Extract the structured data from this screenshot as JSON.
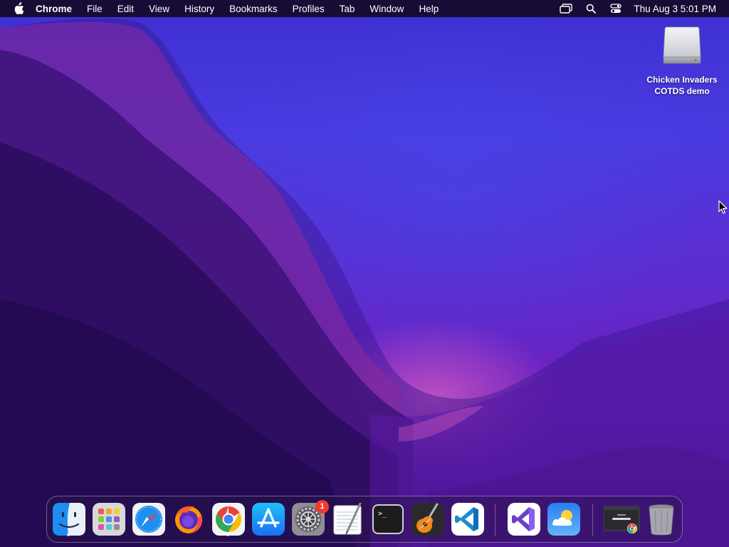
{
  "menubar": {
    "app_name": "Chrome",
    "menus": [
      "File",
      "Edit",
      "View",
      "History",
      "Bookmarks",
      "Profiles",
      "Tab",
      "Window",
      "Help"
    ],
    "clock": "Thu Aug 3  5:01 PM"
  },
  "desktop": {
    "icon_label": "Chicken Invaders COTDS demo"
  },
  "dock": {
    "apps": [
      {
        "name": "Finder",
        "icon": "finder-icon",
        "running": true
      },
      {
        "name": "Launchpad",
        "icon": "launchpad-icon",
        "running": false
      },
      {
        "name": "Safari",
        "icon": "safari-icon",
        "running": false
      },
      {
        "name": "Firefox",
        "icon": "firefox-icon",
        "running": false
      },
      {
        "name": "Google Chrome",
        "icon": "chrome-icon",
        "running": true
      },
      {
        "name": "App Store",
        "icon": "app-store-icon",
        "running": false
      },
      {
        "name": "System Preferences",
        "icon": "system-preferences-icon",
        "running": false,
        "badge": "1"
      },
      {
        "name": "TextEdit",
        "icon": "textedit-icon",
        "running": false
      },
      {
        "name": "Terminal",
        "icon": "terminal-icon",
        "running": false
      },
      {
        "name": "GarageBand",
        "icon": "garageband-icon",
        "running": false
      },
      {
        "name": "Visual Studio Code",
        "icon": "vscode-icon",
        "running": false
      },
      {
        "name": "Visual Studio",
        "icon": "visual-studio-icon",
        "running": false
      },
      {
        "name": "Weather",
        "icon": "weather-icon",
        "running": false
      },
      {
        "name": "Chrome window",
        "icon": "chrome-window-thumbnail-icon",
        "running": false
      },
      {
        "name": "Trash",
        "icon": "trash-icon",
        "running": false
      }
    ]
  },
  "colors": {
    "menubar_bg": "#140a28",
    "badge": "#f23b30",
    "finder_blue": "#1e8cf0",
    "vscode_blue": "#1f8ad2"
  }
}
